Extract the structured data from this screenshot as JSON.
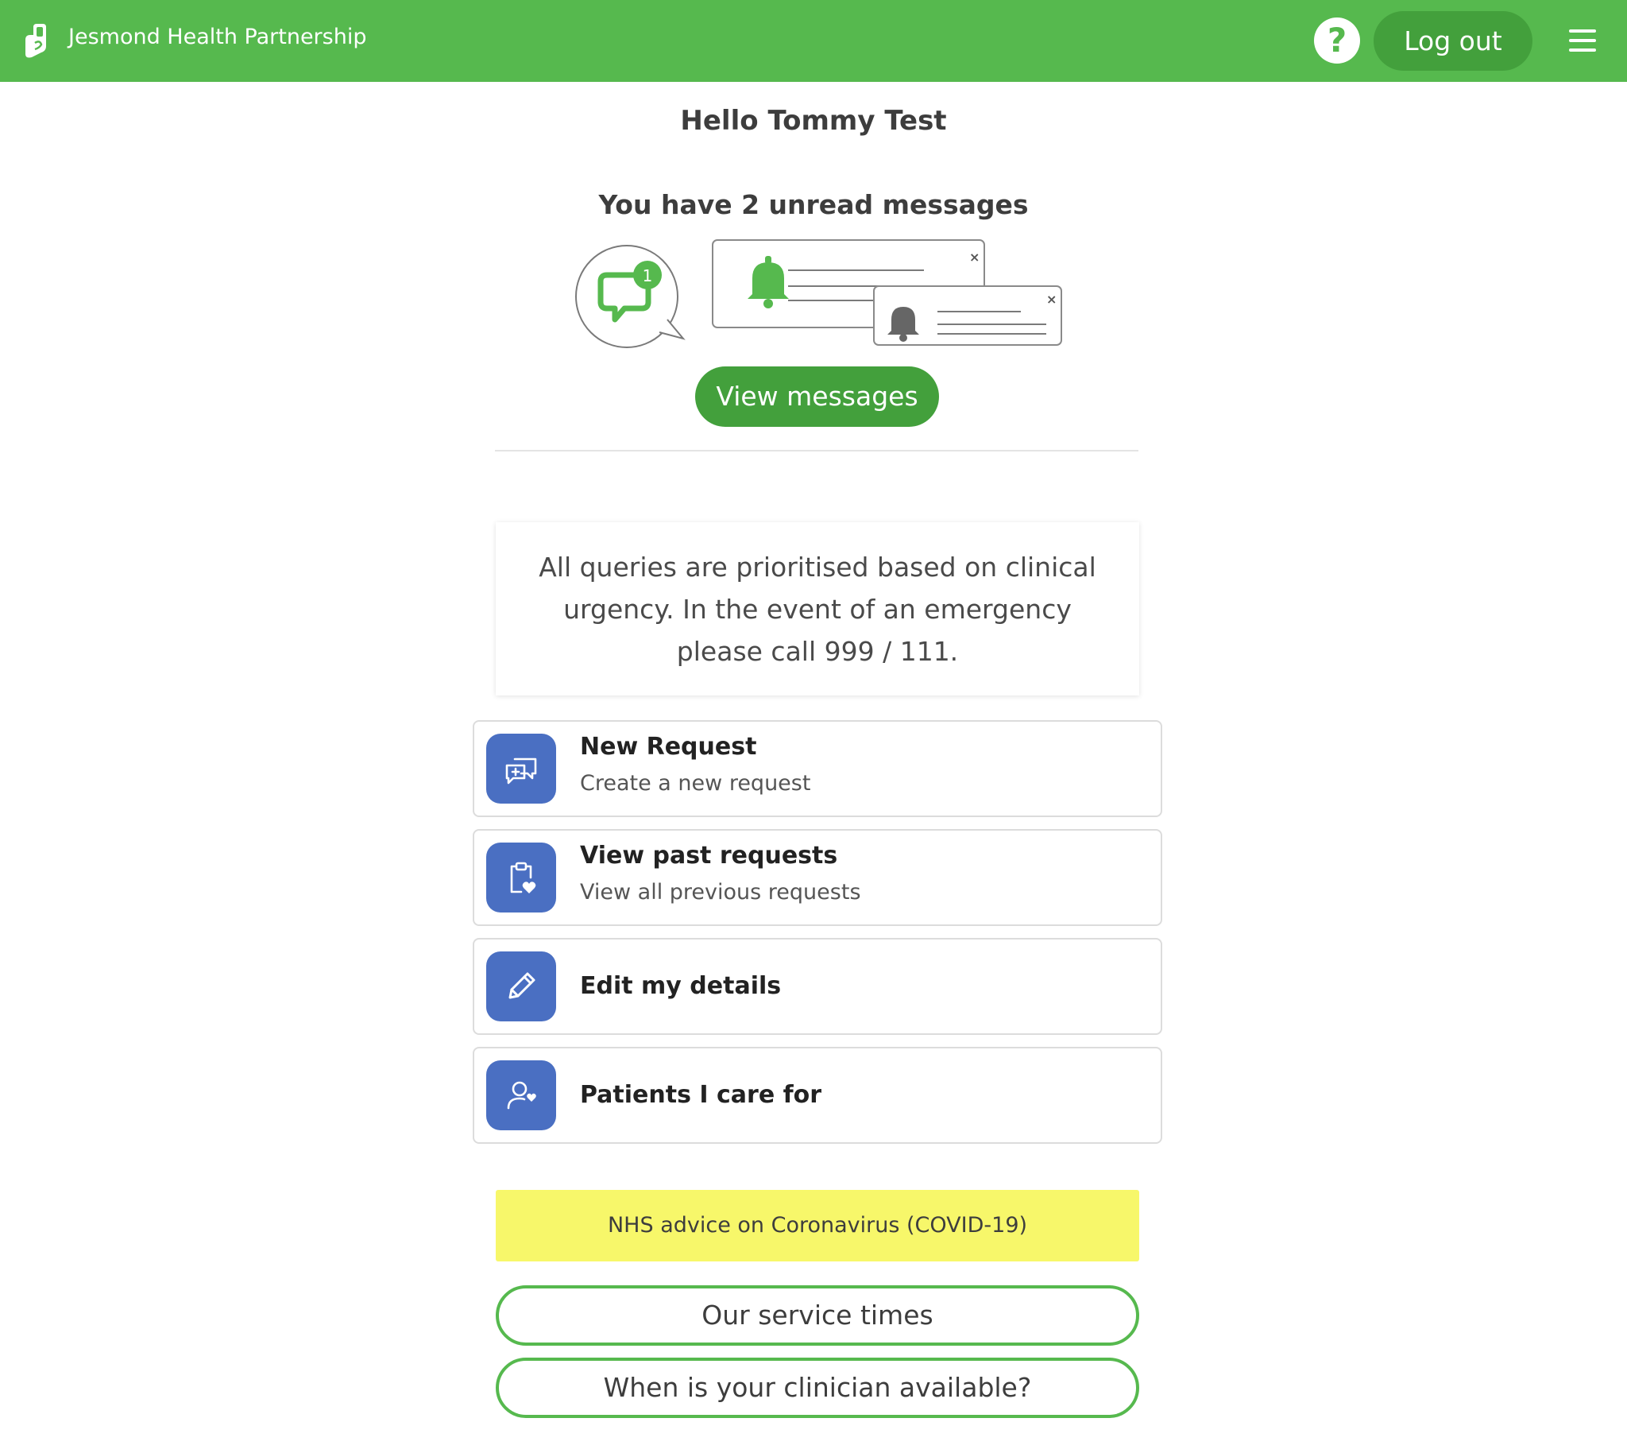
{
  "header": {
    "brand_name": "Jesmond Health Partnership",
    "help_label": "?",
    "logout_label": "Log out",
    "bg_color": "#56b94e"
  },
  "main": {
    "greeting": "Hello Tommy Test",
    "unread_text": "You have 2 unread messages",
    "badge_count": "1",
    "view_messages_label": "View messages",
    "notice": "All queries are prioritised based on clinical urgency. In the event of an emergency please call 999 / 111."
  },
  "menu": {
    "items": [
      {
        "title": "New Request",
        "subtitle": "Create a new request",
        "icon": "chat-plus-icon"
      },
      {
        "title": "View past requests",
        "subtitle": "View all previous requests",
        "icon": "clipboard-heart-icon"
      },
      {
        "title": "Edit my details",
        "subtitle": "",
        "icon": "pencil-icon"
      },
      {
        "title": "Patients I care for",
        "subtitle": "",
        "icon": "person-heart-icon"
      }
    ],
    "tile_color": "#4a6fc2"
  },
  "footer": {
    "covid_link": "NHS advice on Coronavirus (COVID-19)",
    "service_times_label": "Our service times",
    "clinician_label": "When is your clinician available?",
    "banner_color": "#f7f76a"
  }
}
